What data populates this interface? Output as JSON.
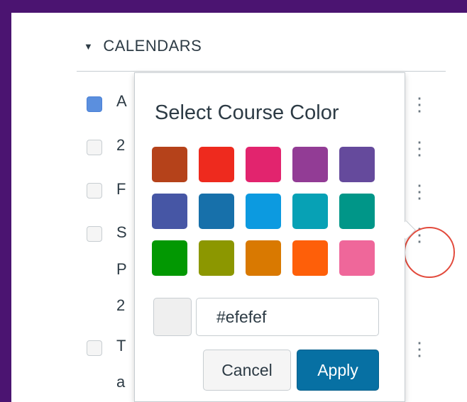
{
  "sidebar": {
    "section_title": "CALENDARS",
    "rows": [
      {
        "text": "A",
        "checked": true
      },
      {
        "text": "2",
        "checked": false
      },
      {
        "text": "F",
        "checked": false
      },
      {
        "text": "S",
        "checked": false
      },
      {
        "text": "P",
        "checked": false
      },
      {
        "text": "2",
        "checked": false
      },
      {
        "text": "T",
        "checked": false
      },
      {
        "text": "a",
        "checked": false
      }
    ]
  },
  "popover": {
    "title": "Select Course Color",
    "swatches": [
      "#b5421a",
      "#ee2a1e",
      "#e2246e",
      "#923c95",
      "#654a9c",
      "#4656a5",
      "#1770aa",
      "#0c9ae0",
      "#07a1b5",
      "#009688",
      "#029802",
      "#8c9700",
      "#d97901",
      "#fe5f09",
      "#ef679a"
    ],
    "preview_color": "#efefef",
    "hex_value": "#efefef",
    "cancel_label": "Cancel",
    "apply_label": "Apply"
  },
  "colors": {
    "background": "#4b1471",
    "apply_button": "#0770a3",
    "annotation": "#e24a3c"
  }
}
